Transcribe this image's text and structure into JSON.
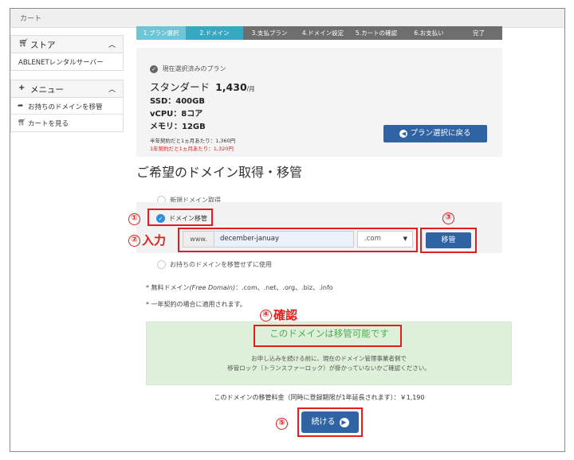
{
  "window": {
    "title": "カート"
  },
  "sidebar": {
    "store": {
      "title": "ストア",
      "items": [
        "ABLENETレンタルサーバー"
      ]
    },
    "menu": {
      "title": "メニュー",
      "items": [
        {
          "label": "お持ちのドメインを移管",
          "icon": "share-arrow-icon"
        },
        {
          "label": "カートを見る",
          "icon": "cart-icon"
        }
      ]
    }
  },
  "steps": [
    {
      "label": "1.プラン選択",
      "state": "done"
    },
    {
      "label": "2.ドメイン",
      "state": "active"
    },
    {
      "label": "3.支払プラン",
      "state": "todo"
    },
    {
      "label": "4.ドメイン設定",
      "state": "todo"
    },
    {
      "label": "5.カートの確認",
      "state": "todo"
    },
    {
      "label": "6.お支払い",
      "state": "todo"
    },
    {
      "label": "完了",
      "state": "todo"
    }
  ],
  "plan": {
    "header": "現在選択済みのプラン",
    "name": "スタンダード",
    "price": "1,430",
    "per": "/月",
    "specs": [
      "SSD：400GB",
      "vCPU：8コア",
      "メモリ：12GB"
    ],
    "price_half": "半年契約だと1ヵ月あたり：1,360円",
    "price_year": "1年契約だと1ヵ月あたり：1,320円",
    "back_button": "プラン選択に戻る"
  },
  "section_title": "ご希望のドメイン取得・移管",
  "options": {
    "new": "新規ドメイン取得",
    "transfer": "ドメイン移管",
    "existing": "お持ちのドメインを移管せずに使用"
  },
  "domain_input": {
    "prefix": "www.",
    "value": "december-januay",
    "tld": ".com"
  },
  "transfer_button": "移管",
  "notes": {
    "free_prefix": "* 無料ドメイン",
    "free_label": "(Free Domain)",
    "free_list": "：.com、.net、.org、.biz、.info",
    "yearly": "* 一年契約の場合に適用されます。"
  },
  "confirm": {
    "status": "このドメインは移管可能です",
    "line1": "お申し込みを続ける前に、現在のドメイン管理事業者側で",
    "line2": "移管ロック（トランスファーロック）が掛かっていないかご確認ください。"
  },
  "fee": "このドメインの移管料金（同時に登録期限が1年延長されます）：￥1,190",
  "continue_button": "続ける",
  "annotations": {
    "a1": "①",
    "a2": "②",
    "a2_text": "入力",
    "a3": "③",
    "a4": "④",
    "a4_text": "確認",
    "a5": "⑤"
  },
  "colors": {
    "primary": "#2f63a4",
    "accent_red": "#e61b1b",
    "success_bg": "#def0d9",
    "success_text": "#4cae4c",
    "step_done": "#6cc6d6",
    "step_active": "#36a8c0"
  }
}
